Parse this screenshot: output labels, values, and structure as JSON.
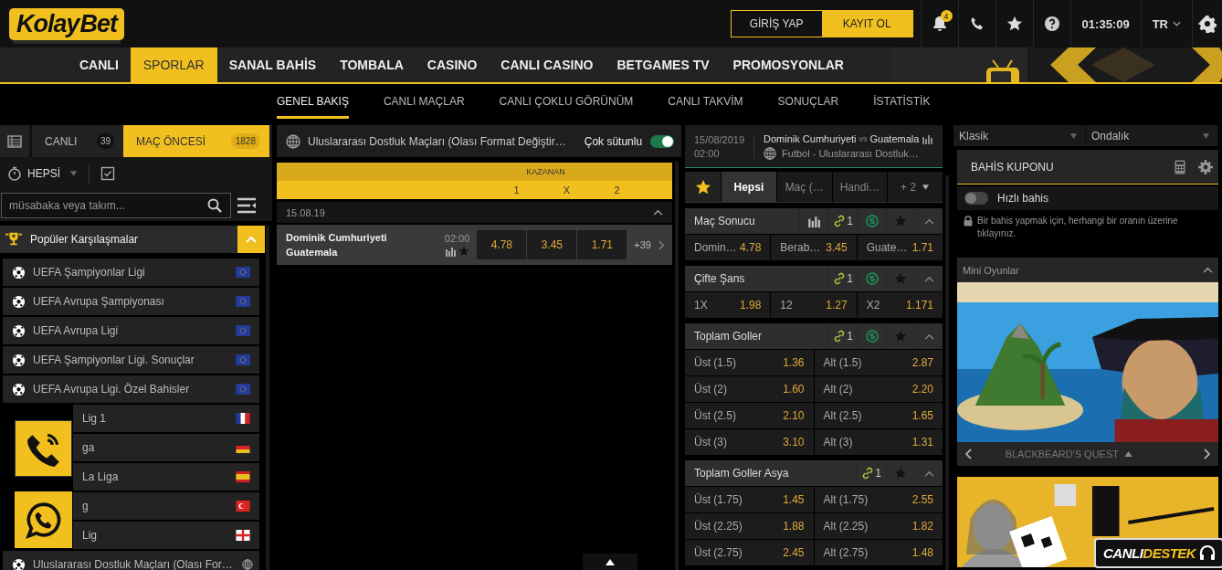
{
  "header": {
    "logo": [
      "Kolay",
      "Bet"
    ],
    "login": "GİRİŞ YAP",
    "register": "KAYIT OL",
    "notifications": "4",
    "time": "01:35:09",
    "language": "TR"
  },
  "nav": [
    {
      "label": "CANLI",
      "selected": false
    },
    {
      "label": "SPORLAR",
      "selected": true
    },
    {
      "label": "SANAL BAHİS",
      "selected": false
    },
    {
      "label": "TOMBALA",
      "selected": false
    },
    {
      "label": "CASINO",
      "selected": false
    },
    {
      "label": "CANLI CASINO",
      "selected": false
    },
    {
      "label": "BETGAMES TV",
      "selected": false
    },
    {
      "label": "PROMOSYONLAR",
      "selected": false
    }
  ],
  "subnav": [
    {
      "label": "GENEL BAKIŞ",
      "selected": true
    },
    {
      "label": "CANLI MAÇLAR",
      "selected": false
    },
    {
      "label": "CANLI ÇOKLU GÖRÜNÜM",
      "selected": false
    },
    {
      "label": "CANLI TAKVİM",
      "selected": false
    },
    {
      "label": "SONUÇLAR",
      "selected": false
    },
    {
      "label": "İSTATİSTİK",
      "selected": false
    }
  ],
  "sidebar": {
    "tabs": [
      {
        "label": "CANLI",
        "count": "39",
        "selected": false
      },
      {
        "label": "MAÇ ÖNCESİ",
        "count": "1828",
        "selected": true
      }
    ],
    "filter": "HEPSİ",
    "search": {
      "placeholder": "müsabaka veya takım..."
    },
    "section": {
      "title": "Popüler Karşılaşmalar",
      "expanded": true
    },
    "leagues": [
      {
        "name": "UEFA Şampiyonlar Ligi",
        "kind": "eu"
      },
      {
        "name": "UEFA Avrupa Şampiyonası",
        "kind": "eu"
      },
      {
        "name": "UEFA Avrupa Ligi",
        "kind": "eu"
      },
      {
        "name": "UEFA Şampiyonlar Ligi. Sonuçlar",
        "kind": "eu"
      },
      {
        "name": "UEFA Avrupa Ligi. Özel Bahisler",
        "kind": "eu"
      },
      {
        "name": "Lig 1",
        "kind": "fr"
      },
      {
        "name": "ga",
        "kind": "de"
      },
      {
        "name": "La Liga",
        "kind": "es"
      },
      {
        "name": "g",
        "kind": "tr"
      },
      {
        "name": "Lig",
        "kind": "en"
      },
      {
        "name": "Uluslararası Dostluk Maçları (Olası For…",
        "kind": "world"
      }
    ]
  },
  "event_list": {
    "title": "Uluslararası Dostluk Maçları (Olası Format Değiştir…",
    "multi_column": {
      "label": "Çok sütunlu",
      "on": true
    },
    "market": "KAZANAN",
    "outcomes": [
      "1",
      "X",
      "2"
    ],
    "date": "15.08.19",
    "matches": [
      {
        "home": "Dominik Cumhuriyeti",
        "away": "Guatemala",
        "time": "02:00",
        "odds": [
          "4.78",
          "3.45",
          "1.71"
        ],
        "more": "+39"
      }
    ]
  },
  "event": {
    "date": "15/08/2019",
    "time": "02:00",
    "home": "Dominik Cumhuriyeti",
    "vs": "vs",
    "away": "Guatemala",
    "league": "Futbol - Uluslararası Dostluk…"
  },
  "market_tabs": [
    {
      "label": "Hepsi",
      "selected": true,
      "kind": "tab"
    },
    {
      "label": "Maç (…",
      "selected": false,
      "kind": "tab"
    },
    {
      "label": "Handi…",
      "selected": false,
      "kind": "tab"
    },
    {
      "label": "+ 2",
      "selected": false,
      "kind": "more"
    }
  ],
  "markets": [
    {
      "name": "Maç Sonucu",
      "stats": true,
      "links": "1",
      "cashout": true,
      "expanded": true,
      "rows": [
        [
          {
            "label": "Domin…",
            "odds": "4.78"
          },
          {
            "label": "Berab…",
            "odds": "3.45"
          },
          {
            "label": "Guate…",
            "odds": "1.71"
          }
        ]
      ]
    },
    {
      "name": "Çifte Şans",
      "stats": false,
      "links": "1",
      "cashout": true,
      "expanded": true,
      "rows": [
        [
          {
            "label": "1X",
            "odds": "1.98"
          },
          {
            "label": "12",
            "odds": "1.27"
          },
          {
            "label": "X2",
            "odds": "1.171"
          }
        ]
      ]
    },
    {
      "name": "Toplam Goller",
      "stats": false,
      "links": "1",
      "cashout": true,
      "expanded": true,
      "rows": [
        [
          {
            "label": "Üst (1.5)",
            "odds": "1.36"
          },
          {
            "label": "Alt (1.5)",
            "odds": "2.87"
          }
        ],
        [
          {
            "label": "Üst (2)",
            "odds": "1.60"
          },
          {
            "label": "Alt (2)",
            "odds": "2.20"
          }
        ],
        [
          {
            "label": "Üst (2.5)",
            "odds": "2.10"
          },
          {
            "label": "Alt (2.5)",
            "odds": "1.65"
          }
        ],
        [
          {
            "label": "Üst (3)",
            "odds": "3.10"
          },
          {
            "label": "Alt (3)",
            "odds": "1.31"
          }
        ]
      ]
    },
    {
      "name": "Toplam Goller Asya",
      "stats": false,
      "links": "1",
      "cashout": false,
      "expanded": true,
      "rows": [
        [
          {
            "label": "Üst (1.75)",
            "odds": "1.45"
          },
          {
            "label": "Alt (1.75)",
            "odds": "2.55"
          }
        ],
        [
          {
            "label": "Üst (2.25)",
            "odds": "1.88"
          },
          {
            "label": "Alt (2.25)",
            "odds": "1.82"
          }
        ],
        [
          {
            "label": "Üst (2.75)",
            "odds": "2.45"
          },
          {
            "label": "Alt (2.75)",
            "odds": "1.48"
          }
        ]
      ]
    }
  ],
  "betslip": {
    "format": "Klasik",
    "odds_format": "Ondalık",
    "title": "BAHİS KUPONU",
    "quick_bet": {
      "label": "Hızlı bahis",
      "on": false
    },
    "hint": "Bir bahis yapmak için, herhangi bir oranın üzerine tıklayınız."
  },
  "mini_games": {
    "title": "Mini Oyunlar",
    "expanded": true,
    "game": "BLACKBEARD'S QUEST"
  },
  "live_support": [
    "CANLI",
    "DESTEK"
  ]
}
